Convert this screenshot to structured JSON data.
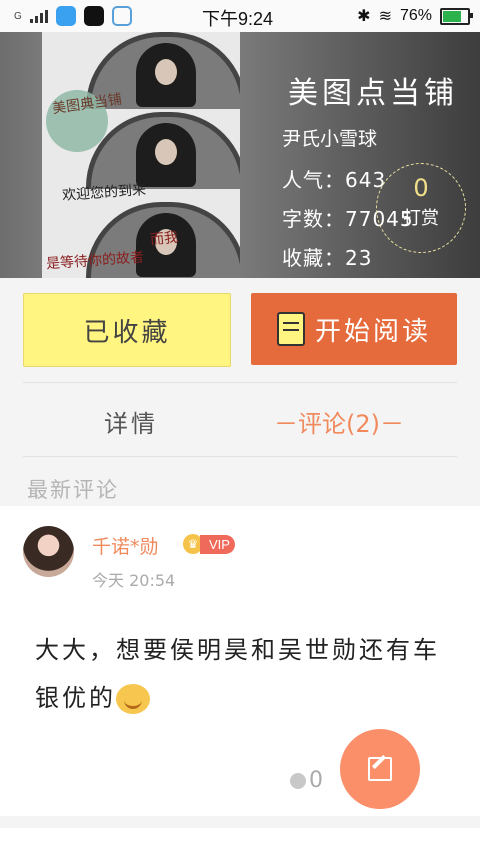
{
  "status_bar": {
    "carrier": "G",
    "time": "下午9:24",
    "battery": "76%",
    "battery_level": 0.76
  },
  "book": {
    "title": "美图点当铺",
    "author": "尹氏小雪球",
    "stats": [
      {
        "label": "人气：",
        "value": "643"
      },
      {
        "label": "字数：",
        "value": "77045"
      },
      {
        "label": "收藏：",
        "value": "23"
      }
    ],
    "reward": {
      "count": "0",
      "label": "打赏"
    },
    "cover": {
      "seal_text": "美图典当铺",
      "welcome": "欢迎您的到来",
      "gu": "而我",
      "wait": "是等待你的故者"
    }
  },
  "actions": {
    "collected_label": "已收藏",
    "read_label": "开始阅读"
  },
  "tabs": {
    "detail": "详情",
    "comments": "－评论(2)－"
  },
  "comments_section": {
    "label": "最新评论",
    "items": [
      {
        "username": "千诺*勋",
        "badge": "VIP",
        "time": "今天 20:54",
        "text": "大大，想要侯明昊和吴世勋还有车银优的",
        "likes": "0"
      }
    ]
  },
  "colors": {
    "accent": "#f08a5d",
    "read_button": "#e66b3c",
    "collect_button": "#fff580",
    "fab": "#fb8f6a"
  },
  "icons": [
    "signal-icon",
    "wifi-icon",
    "bluetooth-icon",
    "battery-icon",
    "book-icon",
    "edit-icon",
    "comment-bubble-icon",
    "crown-icon",
    "smile-emoji-icon"
  ]
}
